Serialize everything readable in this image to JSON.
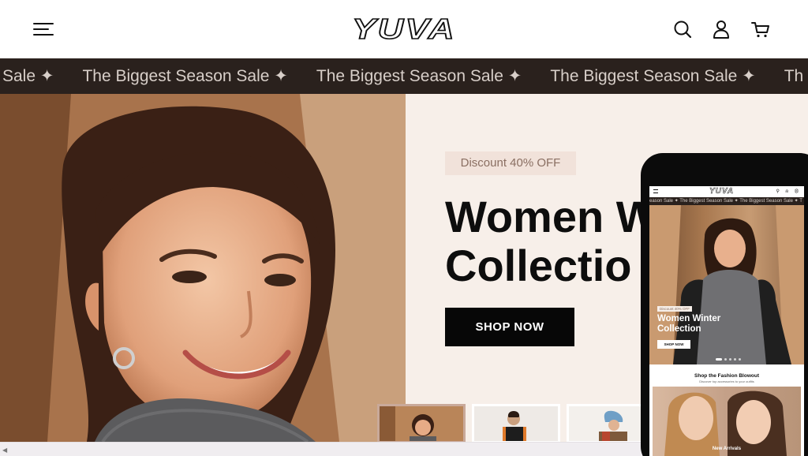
{
  "header": {
    "logo": "YUVA",
    "icons": [
      "menu-icon",
      "search-icon",
      "user-icon",
      "cart-icon"
    ]
  },
  "marquee": {
    "items": [
      "Sale ✦",
      "The Biggest Season Sale ✦",
      "The Biggest Season Sale ✦",
      "The Biggest Season Sale ✦",
      "Th"
    ]
  },
  "hero": {
    "discount": "Discount 40% OFF",
    "title_line1": "Women W",
    "title_line2": "Collectio",
    "cta": "SHOP NOW"
  },
  "phone": {
    "logo": "YUVA",
    "marquee": "eason Sale ✦   The Biggest Season Sale ✦   The Biggest Season Sale ✦   T",
    "discount": "Discount 40% OFF",
    "title_line1": "Women Winter",
    "title_line2": "Collection",
    "cta": "SHOP NOW",
    "section_title": "Shop the Fashion Blowout",
    "section_sub": "Discover top accessories to your outfits",
    "card_label": "New Arrivals"
  },
  "colors": {
    "marquee_bg": "#2a211d",
    "hero_bg": "#f7efe9",
    "button_bg": "#070707"
  }
}
